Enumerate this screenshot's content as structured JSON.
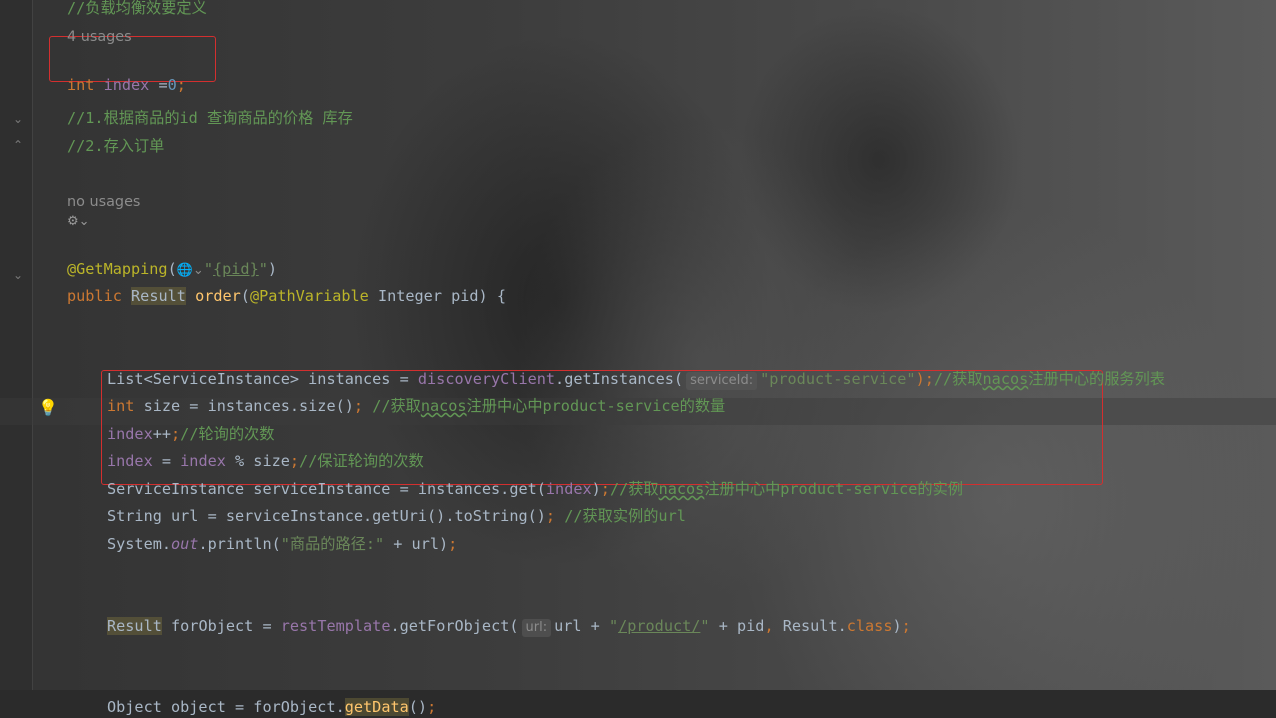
{
  "code": {
    "comment_load_balance": "//负载均衡效要定义",
    "usages_4": "4 usages",
    "line_int": "int",
    "line_index": "index",
    "line_eq": " =",
    "line_zero": "0",
    "line_semi": ";",
    "comment_1": "//1.根据商品的id 查询商品的价格 库存",
    "comment_2": "//2.存入订单",
    "no_usages": "no usages",
    "ai_icon_glyph": "⚙⌄",
    "getmapping": "@GetMapping",
    "gm_open": "(",
    "gm_globe": "🌐⌄",
    "gm_q1": "\"",
    "gm_pid": "{pid}",
    "gm_q2": "\"",
    "gm_close": ")",
    "public": "public",
    "result_type": "Result",
    "order": "order",
    "paren_open": "(",
    "pathvariable": "@PathVariable",
    "integer_pid": " Integer pid) {",
    "list_decl": "List<ServiceInstance> instances = ",
    "discovery_client": "discoveryClient",
    "get_instances": ".getInstances(",
    "hint_service_id": "serviceId:",
    "product_service_str": "\"product-service\"",
    "list_close": ");",
    "list_cmt_1": "//获取",
    "list_cmt_nacos": "nacos",
    "list_cmt_2": "注册中心的服务列表",
    "size_int": "int",
    "size_rest": " size = instances.size()",
    "size_semi": ";",
    "size_cmt_1": " //获取",
    "size_cmt_nacos": "nacos",
    "size_cmt_2": "注册中心中product-service的数量",
    "idx_pp_index": "index",
    "idx_pp_rest": "++",
    "idx_pp_semi": ";",
    "idx_pp_cmt": "//轮询的次数",
    "idx_mod_index1": "index",
    "idx_mod_eq": " = ",
    "idx_mod_index2": "index",
    "idx_mod_rest": " % size",
    "idx_mod_semi": ";",
    "idx_mod_cmt": "//保证轮询的次数",
    "si_decl": "ServiceInstance serviceInstance = instances.get(",
    "si_index": "index",
    "si_close": ")",
    "si_semi": ";",
    "si_cmt_1": "//获取",
    "si_cmt_nacos": "nacos",
    "si_cmt_2": "注册中心中product-service的实例",
    "url_decl": "String url = serviceInstance.getUri().toString()",
    "url_semi": ";",
    "url_cmt": " //获取实例的url",
    "sys_1": "System.",
    "sys_out": "out",
    "sys_2": ".println(",
    "sys_str": "\"商品的路径:\"",
    "sys_3": " + url)",
    "sys_semi": ";",
    "rt_result": "Result",
    "rt_1": " forObject = ",
    "rt_field": "restTemplate",
    "rt_2": ".getForObject(",
    "hint_url": "url:",
    "rt_3": "url + ",
    "rt_q1": "\"",
    "rt_path": "/product/",
    "rt_q2": "\"",
    "rt_4": " + pid",
    "rt_comma": ",",
    "rt_5": " Result.",
    "rt_class": "class",
    "rt_close": ")",
    "rt_semi": ";",
    "obj_1": "Object object = forObject.",
    "obj_getdata": "getData",
    "obj_2": "()",
    "obj_semi": ";"
  },
  "colors": {
    "keyword": "#cc7832",
    "comment": "#629755",
    "annotation": "#bbb529",
    "field": "#9876aa",
    "highlight_box": "#d32f2f"
  }
}
